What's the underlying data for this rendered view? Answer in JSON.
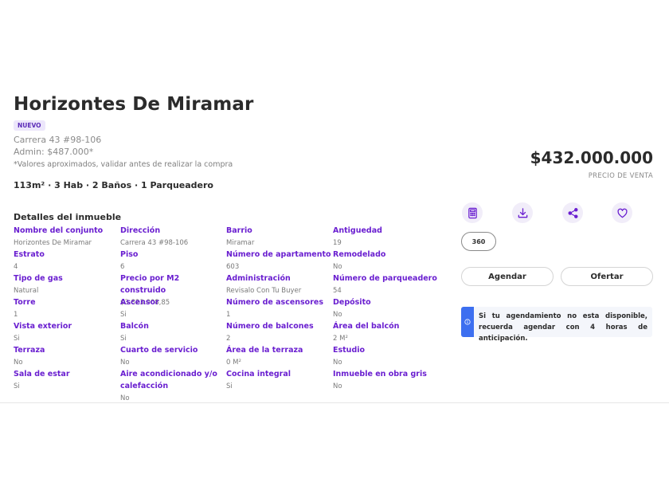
{
  "listing": {
    "title": "Horizontes De Miramar",
    "badge": "NUEVO",
    "address": "Carrera 43 #98-106",
    "admin": "Admin: $487.000*",
    "note": "*Valores aproximados, validar antes de realizar la compra",
    "summary": "113m² · 3 Hab · 2 Baños · 1 Parqueadero",
    "price": "$432.000.000",
    "price_label": "PRECIO DE VENTA"
  },
  "details": {
    "title": "Detalles del inmueble",
    "items": [
      {
        "label": "Nombre del conjunto",
        "value": "Horizontes De Miramar"
      },
      {
        "label": "Dirección",
        "value": "Carrera 43 #98-106"
      },
      {
        "label": "Barrio",
        "value": "Miramar"
      },
      {
        "label": "Antiguedad",
        "value": "19"
      },
      {
        "label": "Estrato",
        "value": "4"
      },
      {
        "label": "Piso",
        "value": "6"
      },
      {
        "label": "Número de apartamento",
        "value": "603"
      },
      {
        "label": "Remodelado",
        "value": "No"
      },
      {
        "label": "Tipo de gas",
        "value": "Natural"
      },
      {
        "label": "Precio por M2 construido",
        "value": "$3.823.008,85"
      },
      {
        "label": "Administración",
        "value": "Revisalo Con Tu Buyer"
      },
      {
        "label": "Número de parqueadero",
        "value": "54"
      },
      {
        "label": "Torre",
        "value": "1"
      },
      {
        "label": "Ascensor",
        "value": "Si"
      },
      {
        "label": "Número de ascensores",
        "value": "1"
      },
      {
        "label": "Depósito",
        "value": "No"
      },
      {
        "label": "Vista exterior",
        "value": "Si"
      },
      {
        "label": "Balcón",
        "value": "Si"
      },
      {
        "label": "Número de balcones",
        "value": "2"
      },
      {
        "label": "Área del balcón",
        "value": "2 M²"
      },
      {
        "label": "Terraza",
        "value": "No"
      },
      {
        "label": "Cuarto de servicio",
        "value": "No"
      },
      {
        "label": "Área de la terraza",
        "value": "0 M²"
      },
      {
        "label": "Estudio",
        "value": "No"
      },
      {
        "label": "Sala de estar",
        "value": "Si"
      },
      {
        "label": "Aire acondicionado y/o calefacción",
        "value": "No"
      },
      {
        "label": "Cocina integral",
        "value": "Si"
      },
      {
        "label": "Inmueble en obra gris",
        "value": "No"
      }
    ]
  },
  "actions": {
    "icons": [
      "calculator-icon",
      "download-icon",
      "share-icon",
      "heart-icon"
    ],
    "tour_label": "360",
    "schedule_label": "Agendar",
    "offer_label": "Ofertar"
  },
  "alert": {
    "text": "Si tu agendamiento no esta disponible, recuerda agendar con 4 horas de anticipación."
  },
  "colors": {
    "accent": "#6a1fd0",
    "icon_bg": "#f1edf9",
    "alert_bar": "#3d6ff0"
  }
}
